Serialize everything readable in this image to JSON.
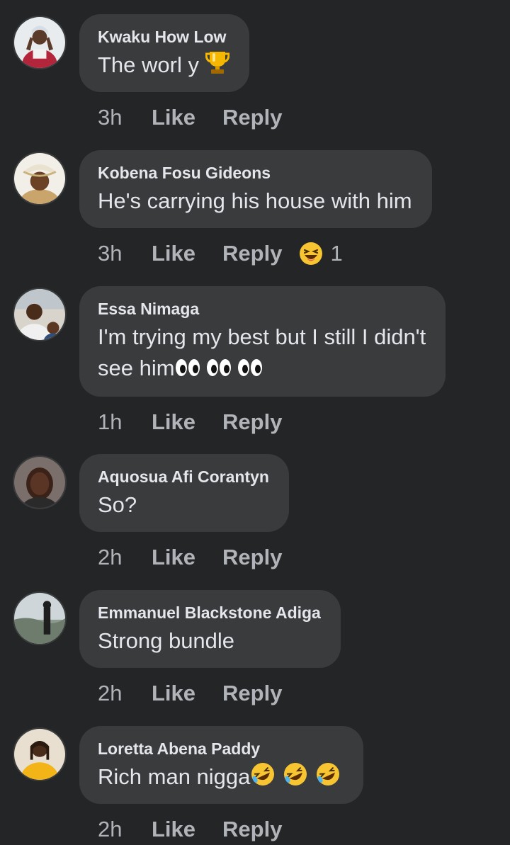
{
  "comments": [
    {
      "author": "Kwaku How Low",
      "text": "The worl y",
      "emoji": "trophy-icon",
      "time": "3h",
      "like": "Like",
      "reply": "Reply"
    },
    {
      "author": "Kobena Fosu Gideons",
      "text": "He's carrying his house with him",
      "time": "3h",
      "like": "Like",
      "reply": "Reply",
      "reaction": {
        "icon": "laughing-face-icon",
        "count": "1"
      }
    },
    {
      "author": "Essa Nimaga",
      "line1": "I'm trying my best but I still I didn't",
      "line2": "see him",
      "emoji": "eyes-icon",
      "time": "1h",
      "like": "Like",
      "reply": "Reply"
    },
    {
      "author": "Aquosua Afi Corantyn",
      "text": "So?",
      "time": "2h",
      "like": "Like",
      "reply": "Reply"
    },
    {
      "author": "Emmanuel Blackstone Adiga",
      "text": "Strong bundle",
      "time": "2h",
      "like": "Like",
      "reply": "Reply"
    },
    {
      "author": "Loretta Abena Paddy",
      "text": "Rich man nigga",
      "emoji": "rolling-on-floor-laughing-icon",
      "time": "2h",
      "like": "Like",
      "reply": "Reply"
    }
  ],
  "colors": {
    "background": "#242526",
    "bubble": "#3a3b3c",
    "primary_text": "#e4e6eb",
    "secondary_text": "#b0b3b8"
  }
}
